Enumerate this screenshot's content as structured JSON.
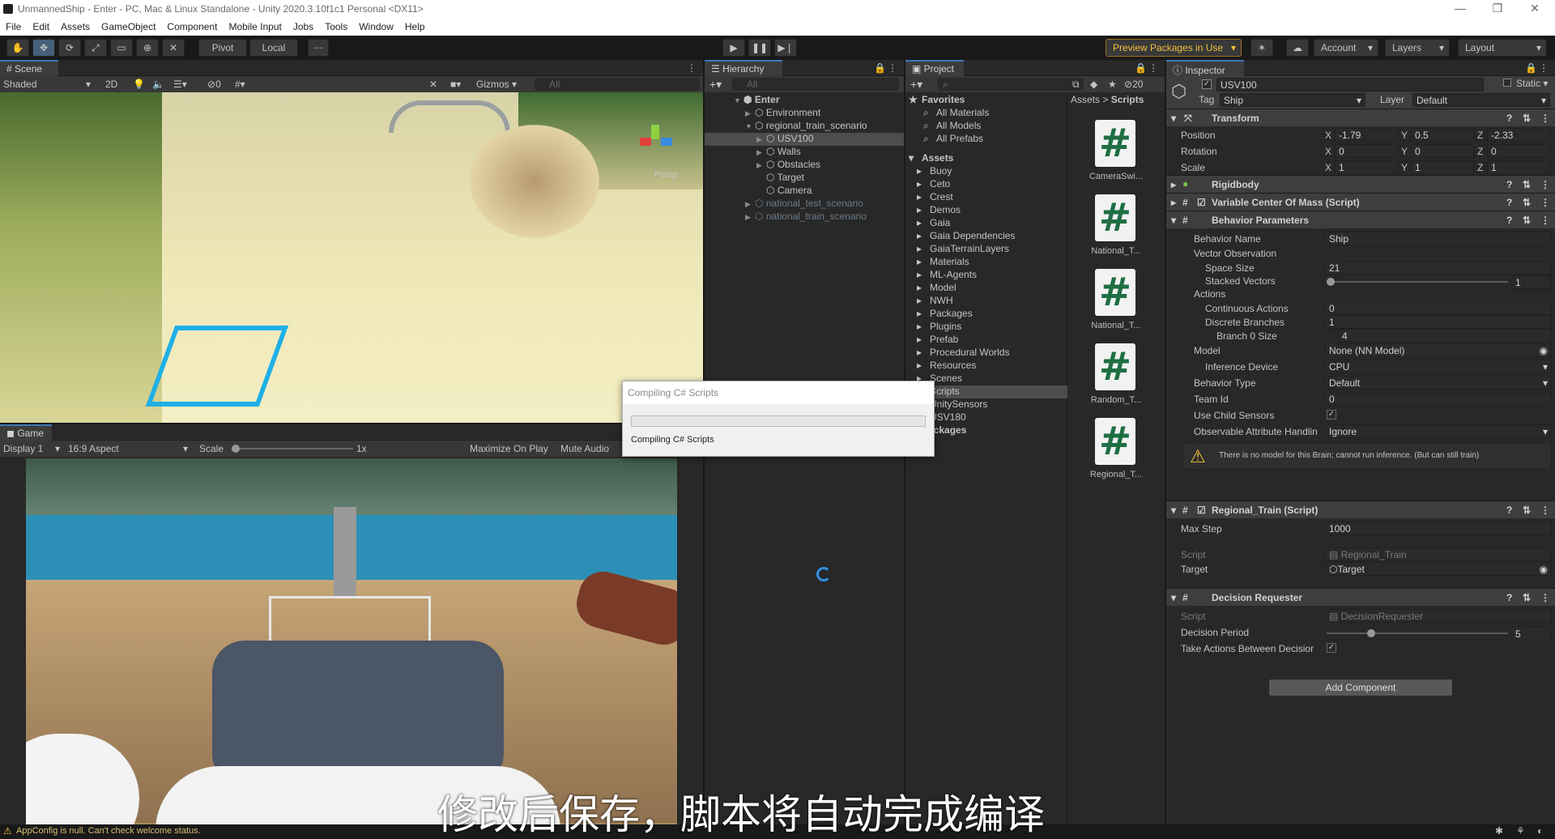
{
  "window": {
    "title": "UnmannedShip - Enter - PC, Mac & Linux Standalone - Unity 2020.3.10f1c1 Personal <DX11>",
    "min": "—",
    "max": "❐",
    "close": "✕"
  },
  "menu": [
    "File",
    "Edit",
    "Assets",
    "GameObject",
    "Component",
    "Mobile Input",
    "Jobs",
    "Tools",
    "Window",
    "Help"
  ],
  "toolbar": {
    "pivot": "Pivot",
    "local": "Local",
    "preview_packages": "Preview Packages in Use",
    "account": "Account",
    "layers": "Layers",
    "layout": "Layout"
  },
  "scene": {
    "tab": "Scene",
    "shading": "Shaded",
    "mode2d": "2D",
    "gizmos": "Gizmos",
    "search_placeholder": "All",
    "fx_count": "0",
    "persp": "Persp"
  },
  "game": {
    "tab": "Game",
    "display": "Display 1",
    "aspect": "16:9 Aspect",
    "scale_label": "Scale",
    "scale_value": "1x",
    "maximize": "Maximize On Play",
    "mute": "Mute Audio"
  },
  "hierarchy": {
    "tab": "Hierarchy",
    "search_placeholder": "All",
    "items": [
      {
        "label": "Enter",
        "indent": 0,
        "expanded": true,
        "bold": true,
        "selected": false,
        "dim": false
      },
      {
        "label": "Environment",
        "indent": 1,
        "expanded": false,
        "bold": false,
        "selected": false,
        "dim": false
      },
      {
        "label": "regional_train_scenario",
        "indent": 1,
        "expanded": true,
        "bold": false,
        "selected": false,
        "dim": false
      },
      {
        "label": "USV100",
        "indent": 2,
        "expanded": false,
        "bold": false,
        "selected": true,
        "dim": false
      },
      {
        "label": "Walls",
        "indent": 2,
        "expanded": false,
        "bold": false,
        "selected": false,
        "dim": false
      },
      {
        "label": "Obstacles",
        "indent": 2,
        "expanded": false,
        "bold": false,
        "selected": false,
        "dim": false
      },
      {
        "label": "Target",
        "indent": 2,
        "expanded": null,
        "bold": false,
        "selected": false,
        "dim": false
      },
      {
        "label": "Camera",
        "indent": 2,
        "expanded": null,
        "bold": false,
        "selected": false,
        "dim": false
      },
      {
        "label": "national_test_scenario",
        "indent": 1,
        "expanded": false,
        "bold": false,
        "selected": false,
        "dim": true
      },
      {
        "label": "national_train_scenario",
        "indent": 1,
        "expanded": false,
        "bold": false,
        "selected": false,
        "dim": true
      }
    ]
  },
  "project": {
    "tab": "Project",
    "count": "20",
    "breadcrumb_root": "Assets",
    "breadcrumb_leaf": "Scripts",
    "favorites_label": "Favorites",
    "favorites": [
      "All Materials",
      "All Models",
      "All Prefabs"
    ],
    "assets_label": "Assets",
    "folders": [
      "Buoy",
      "Ceto",
      "Crest",
      "Demos",
      "Gaia",
      "Gaia Dependencies",
      "GaiaTerrainLayers",
      "Materials",
      "ML-Agents",
      "Model",
      "NWH",
      "Packages",
      "Plugins",
      "Prefab",
      "Procedural Worlds",
      "Resources",
      "Scenes",
      "Scripts",
      "UnitySensors",
      "USV180"
    ],
    "packages_label": "Packages",
    "scripts": [
      "CameraSwi...",
      "National_T...",
      "National_T...",
      "Random_T...",
      "Regional_T..."
    ]
  },
  "inspector": {
    "tab": "Inspector",
    "object_name": "USV100",
    "static": "Static",
    "tag_label": "Tag",
    "tag": "Ship",
    "layer_label": "Layer",
    "layer": "Default",
    "transform": {
      "title": "Transform",
      "position_label": "Position",
      "rotation_label": "Rotation",
      "scale_label": "Scale",
      "axis": [
        "X",
        "Y",
        "Z"
      ],
      "position": [
        "-1.79",
        "0.5",
        "-2.33"
      ],
      "rotation": [
        "0",
        "0",
        "0"
      ],
      "scale": [
        "1",
        "1",
        "1"
      ]
    },
    "rigidbody": "Rigidbody",
    "vcom": "Variable Center Of Mass (Script)",
    "behavior": {
      "title": "Behavior Parameters",
      "name_label": "Behavior Name",
      "name": "Ship",
      "vecobs": "Vector Observation",
      "space_label": "Space Size",
      "space": "21",
      "stacked_label": "Stacked Vectors",
      "stacked": "1",
      "actions": "Actions",
      "cont_label": "Continuous Actions",
      "cont": "0",
      "disc_label": "Discrete Branches",
      "disc": "1",
      "branch_label": "Branch 0 Size",
      "branch": "4",
      "model_label": "Model",
      "model": "None (NN Model)",
      "device_label": "Inference Device",
      "device": "CPU",
      "type_label": "Behavior Type",
      "type": "Default",
      "team_label": "Team Id",
      "team": "0",
      "child_label": "Use Child Sensors",
      "obs_label": "Observable Attribute Handlin",
      "obs": "Ignore",
      "warning": "There is no model for this Brain; cannot run inference. (But can still train)"
    },
    "regional": {
      "title": "Regional_Train (Script)",
      "max_label": "Max Step",
      "max": "1000",
      "script_label": "Script",
      "script": "Regional_Train",
      "target_label": "Target",
      "target": "Target"
    },
    "decision": {
      "title": "Decision Requester",
      "script_label": "Script",
      "script": "DecisionRequester",
      "period_label": "Decision Period",
      "period": "5",
      "take_label": "Take Actions Between Decisior"
    },
    "add_component": "Add Component"
  },
  "dialog": {
    "title": "Compiling C# Scripts",
    "message": "Compiling C# Scripts"
  },
  "status": {
    "message": "AppConfig is null. Can't check welcome status."
  },
  "subtitle": "修改后保存，脚本将自动完成编译"
}
